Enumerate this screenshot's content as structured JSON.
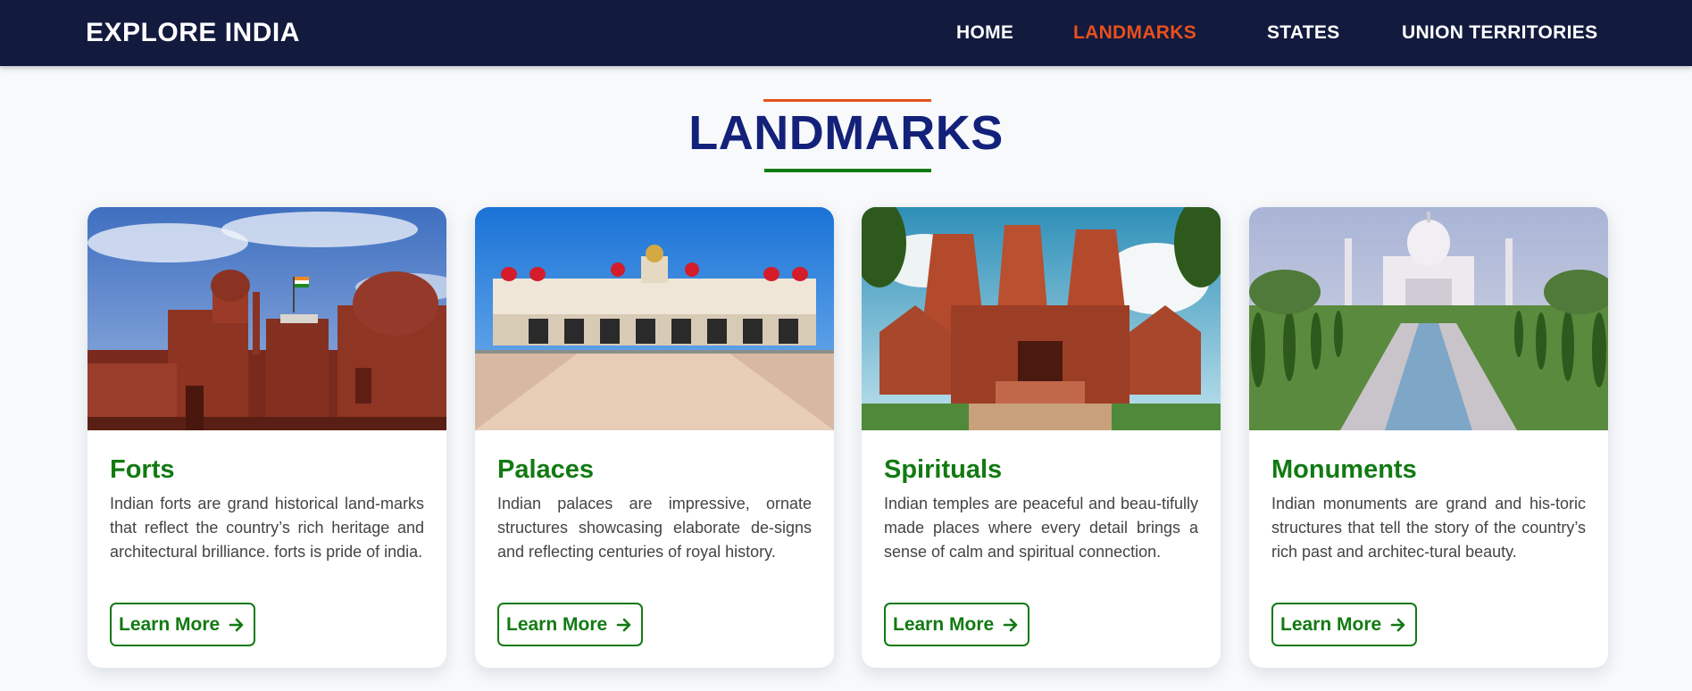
{
  "nav": {
    "brand": "EXPLORE INDIA",
    "links": [
      {
        "label": "HOME"
      },
      {
        "label": "LANDMARKS",
        "active": true
      },
      {
        "label": "STATES"
      },
      {
        "label": "UNION TERRITORIES"
      }
    ]
  },
  "page": {
    "title": "LANDMARKS",
    "accent_top": "#e8501c",
    "accent_bottom": "#127a12"
  },
  "cards": [
    {
      "title": "Forts",
      "image": "red-fort-photo",
      "text": "Indian forts are grand historical land-marks that reflect the country’s rich heritage and architectural brilliance. forts is pride of india.",
      "button": "Learn More"
    },
    {
      "title": "Palaces",
      "image": "mysore-palace-photo",
      "text": "Indian palaces are impressive, ornate structures showcasing elaborate de-signs and reflecting centuries of royal history.",
      "button": "Learn More"
    },
    {
      "title": "Spirituals",
      "image": "temple-photo",
      "text": "Indian temples are peaceful and beau-tifully made places where every detail brings a sense of calm and spiritual connection.",
      "button": "Learn More"
    },
    {
      "title": "Monuments",
      "image": "taj-mahal-photo",
      "text": "Indian monuments are grand and his-toric structures that tell the story of the country’s rich past and architec-tural beauty.",
      "button": "Learn More"
    }
  ],
  "colors": {
    "navbar_bg": "#121a3e",
    "title_blue": "#13217a",
    "green": "#127a12",
    "orange": "#e8501c"
  },
  "icons": {
    "button_arrow": "arrow-right-icon"
  }
}
